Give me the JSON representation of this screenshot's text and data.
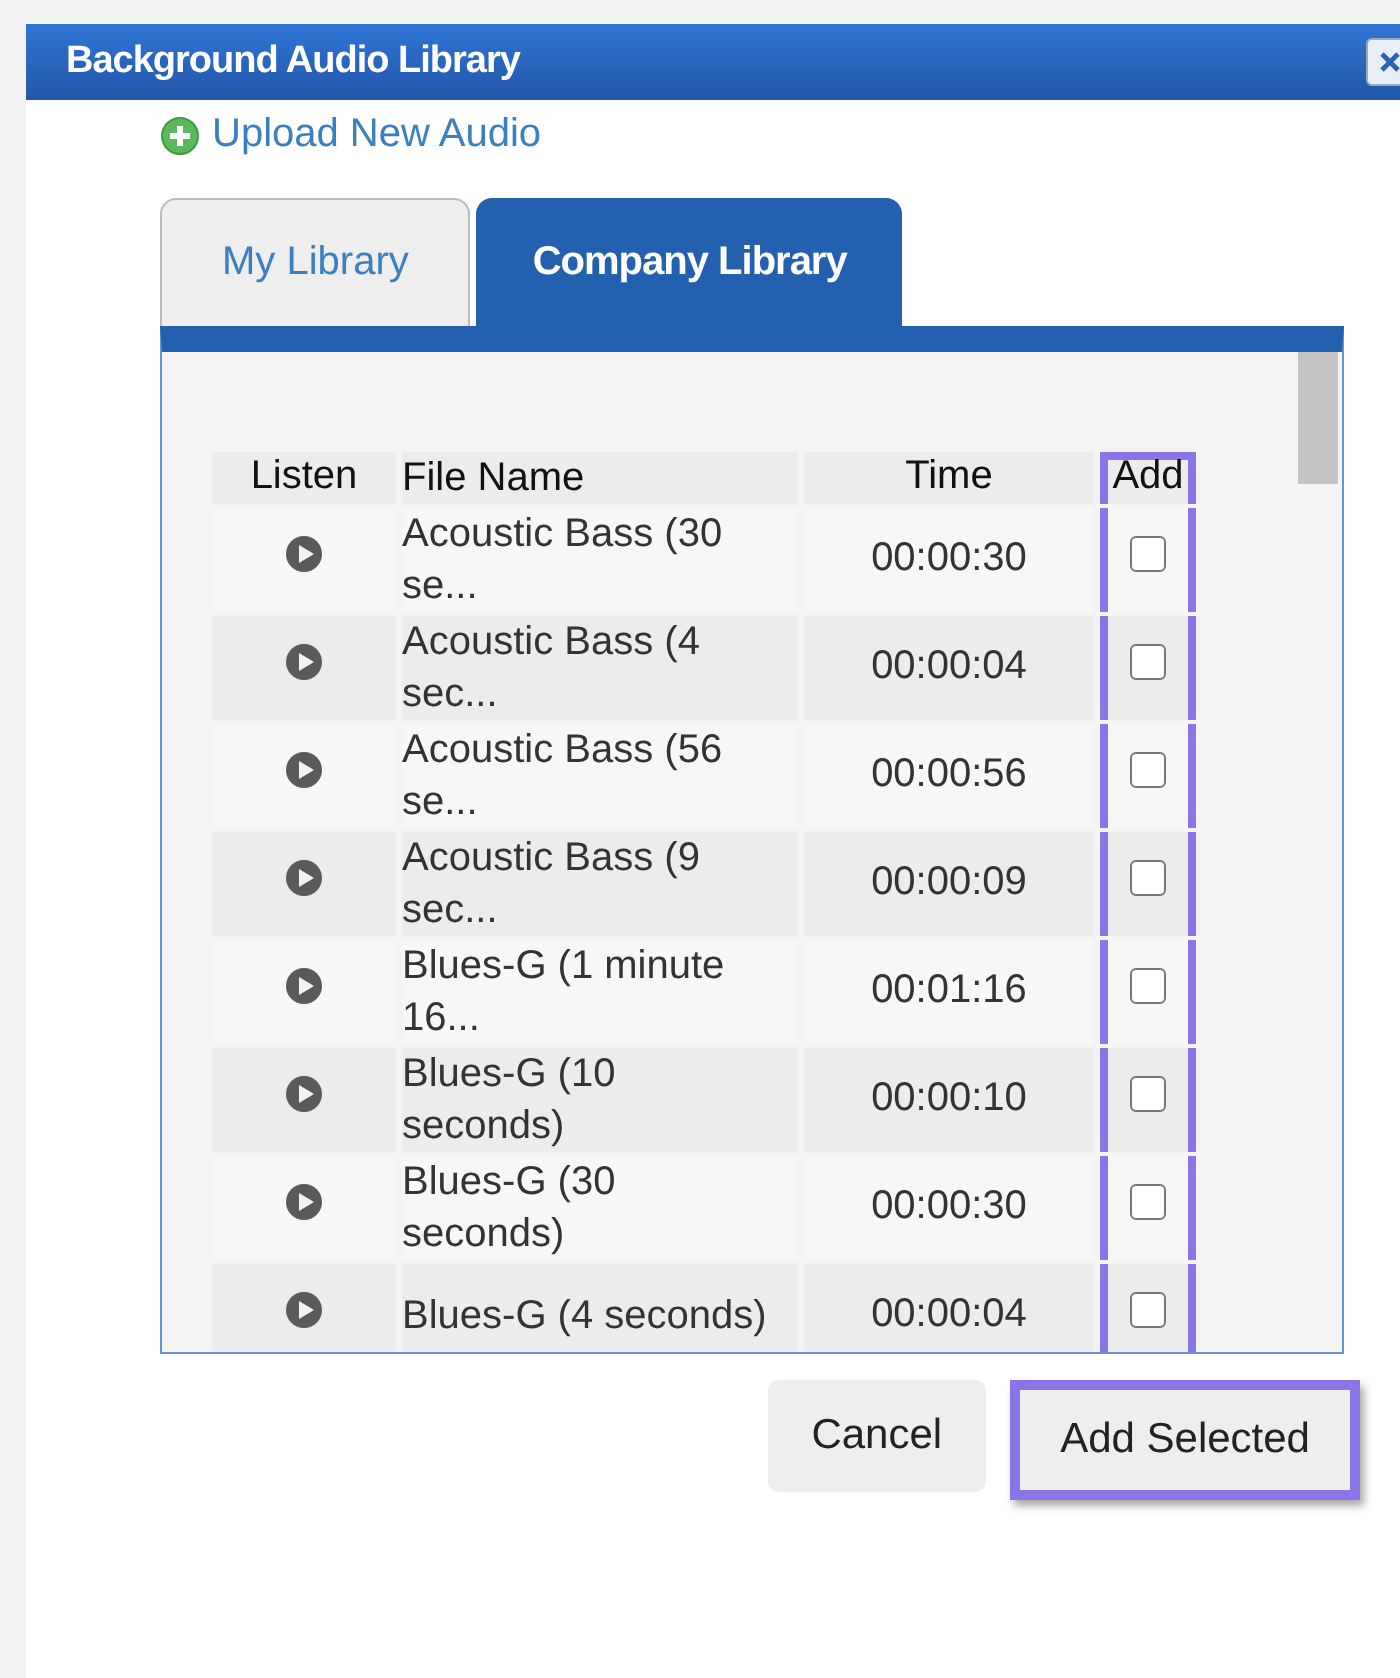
{
  "window": {
    "title": "Background Audio Library"
  },
  "upload_link": "Upload New Audio",
  "tabs": [
    {
      "label": "My Library",
      "selected": false
    },
    {
      "label": "Company Library",
      "selected": true
    }
  ],
  "table": {
    "columns": [
      {
        "label": "Listen",
        "highlighted": false
      },
      {
        "label": "File Name",
        "highlighted": false
      },
      {
        "label": "Time",
        "highlighted": false
      },
      {
        "label": "Add",
        "highlighted": true
      }
    ],
    "rows": [
      {
        "file_name": "Acoustic Bass (30 se...",
        "time": "00:00:30",
        "checked": false
      },
      {
        "file_name": "Acoustic Bass (4 sec...",
        "time": "00:00:04",
        "checked": false
      },
      {
        "file_name": "Acoustic Bass (56 se...",
        "time": "00:00:56",
        "checked": false
      },
      {
        "file_name": "Acoustic Bass (9 sec...",
        "time": "00:00:09",
        "checked": false
      },
      {
        "file_name": "Blues-G (1 minute 16...",
        "time": "00:01:16",
        "checked": false
      },
      {
        "file_name": "Blues-G (10 seconds)",
        "time": "00:00:10",
        "checked": false
      },
      {
        "file_name": "Blues-G (30 seconds)",
        "time": "00:00:30",
        "checked": false
      },
      {
        "file_name": "Blues-G (4 seconds)",
        "time": "00:00:04",
        "checked": false
      }
    ]
  },
  "buttons": [
    {
      "label": "Cancel",
      "highlighted": false
    },
    {
      "label": "Add Selected",
      "highlighted": true
    }
  ]
}
